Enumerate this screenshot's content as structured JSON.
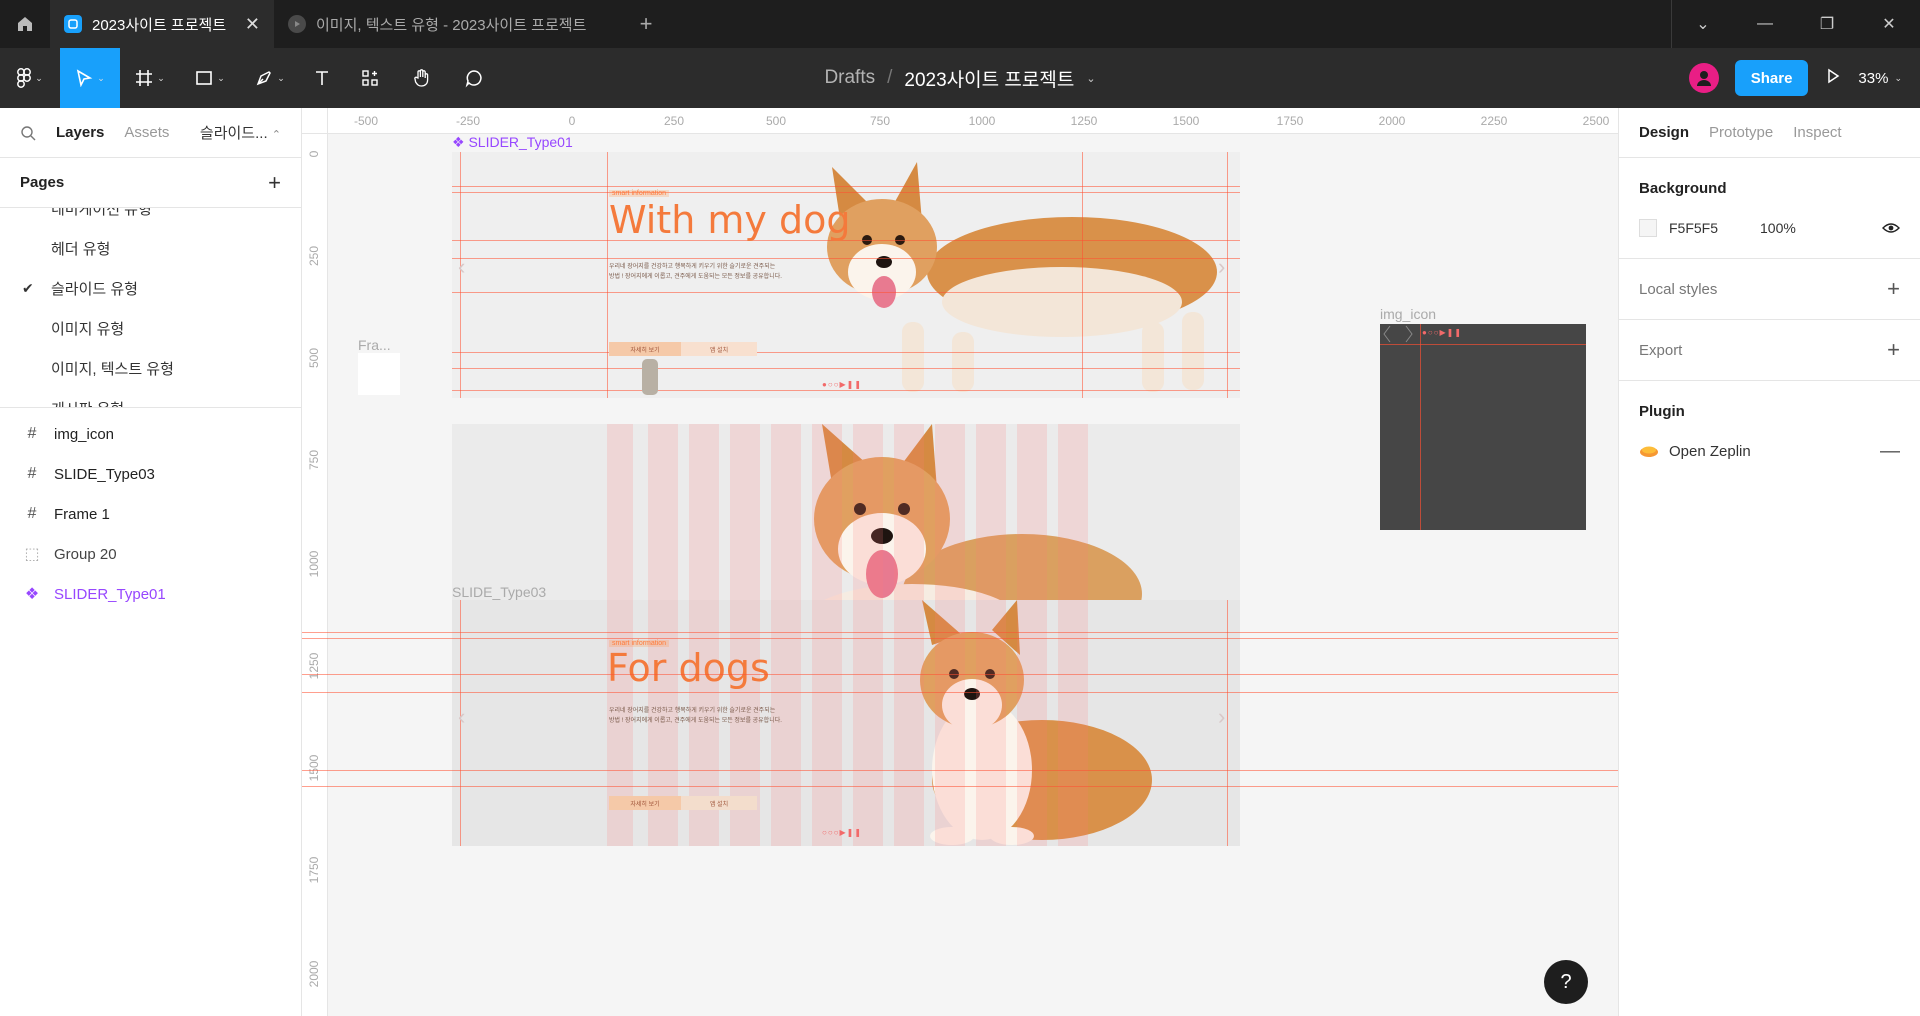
{
  "tabs": [
    {
      "label": "2023사이트 프로젝트",
      "active": true
    },
    {
      "label": "이미지, 텍스트 유형 - 2023사이트 프로젝트",
      "active": false
    }
  ],
  "toolbar": {
    "breadcrumb_root": "Drafts",
    "breadcrumb_sep": "/",
    "doc_name": "2023사이트 프로젝트",
    "share_label": "Share",
    "zoom": "33%"
  },
  "left_panel": {
    "tab_layers": "Layers",
    "tab_assets": "Assets",
    "page_selector": "슬라이드...",
    "pages_title": "Pages",
    "pages": [
      {
        "label": "네비게이션 유형",
        "checked": false
      },
      {
        "label": "헤더 유형",
        "checked": false
      },
      {
        "label": "슬라이드 유형",
        "checked": true
      },
      {
        "label": "이미지 유형",
        "checked": false
      },
      {
        "label": "이미지, 텍스트 유형",
        "checked": false
      },
      {
        "label": "게시판 유형",
        "checked": false
      }
    ],
    "layers": [
      {
        "label": "img_icon",
        "kind": "frame"
      },
      {
        "label": "SLIDE_Type03",
        "kind": "frame"
      },
      {
        "label": "Frame 1",
        "kind": "frame"
      },
      {
        "label": "Group 20",
        "kind": "group"
      },
      {
        "label": "SLIDER_Type01",
        "kind": "component"
      }
    ]
  },
  "canvas": {
    "ruler_top": [
      "-500",
      "-250",
      "0",
      "250",
      "500",
      "750",
      "1000",
      "1250",
      "1500",
      "1750",
      "2000",
      "2250",
      "2500"
    ],
    "ruler_left": [
      "0",
      "250",
      "500",
      "750",
      "1000",
      "1250",
      "1500",
      "1750",
      "2000"
    ],
    "frame_labels": {
      "slider_type01": "SLIDER_Type01",
      "slide_type03": "SLIDE_Type03",
      "img_icon": "img_icon",
      "small_frame": "Fra..."
    },
    "slide1": {
      "small_tag": "smart information",
      "title": "With my dog",
      "desc_line1": "우리네 장어지를 건강하고 행복하게 키우기 위한 슬기로운 견주되는",
      "desc_line2": "방법 ! 장어지에게 이롭고, 견주에게 도움되는 모든 정보를 공유합니다.",
      "btn1": "자세히 보기",
      "btn2": "앱 설치",
      "dots": "●○○▶❚❚"
    },
    "slide3": {
      "small_tag": "smart information",
      "title": "For dogs",
      "desc_line1": "우리네 장어지를 건강하고 행복하게 키우기 위한 슬기로운 견주되는",
      "desc_line2": "방법 ! 장어지에게 이롭고, 견주에게 도움되는 모든 정보를 공유합니다.",
      "btn1": "자세히 보기",
      "btn2": "앱 설치",
      "dots": "○○○▶❚❚"
    },
    "img_icon_dots": "●○○▶❚❚",
    "help": "?"
  },
  "right_panel": {
    "tab_design": "Design",
    "tab_prototype": "Prototype",
    "tab_inspect": "Inspect",
    "background_title": "Background",
    "background_hex": "F5F5F5",
    "background_opacity": "100%",
    "local_styles": "Local styles",
    "export": "Export",
    "plugin_title": "Plugin",
    "plugin_name": "Open Zeplin"
  },
  "colors": {
    "accent": "#18a0fb",
    "component": "#9747ff",
    "guide": "#ff5032",
    "hero_text": "#f47a3c"
  }
}
